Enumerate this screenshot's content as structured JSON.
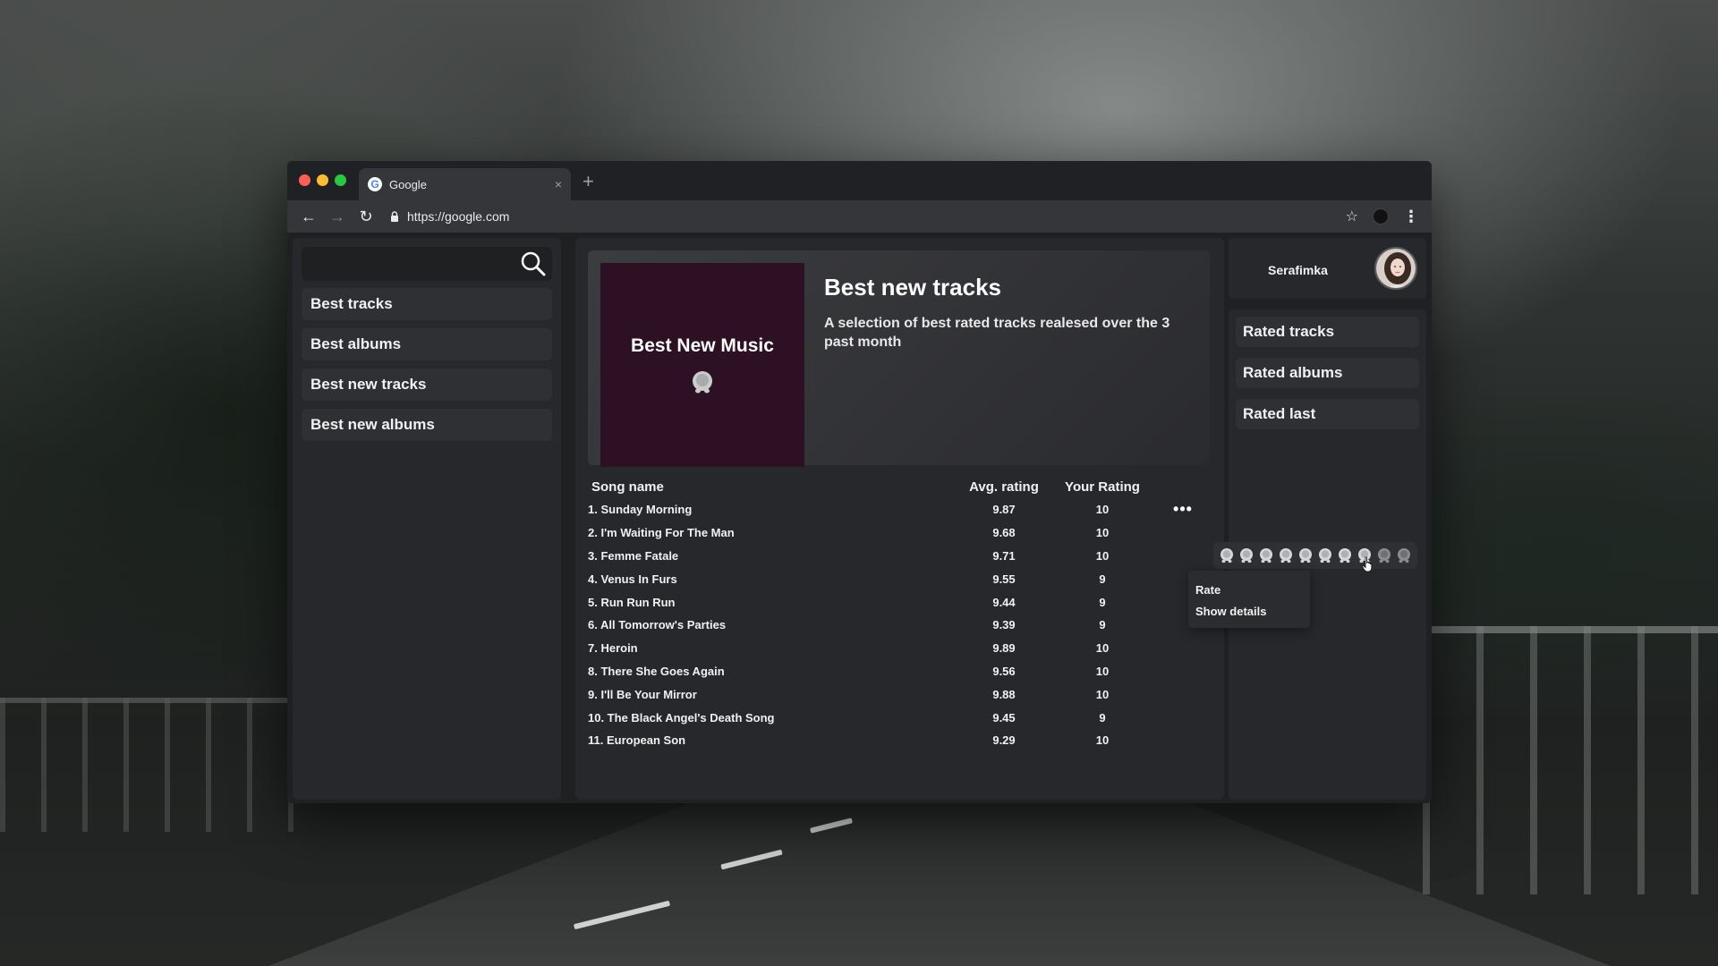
{
  "browser": {
    "tab_title": "Google",
    "tab_favicon": "G",
    "new_tab": "+",
    "close": "×",
    "url": "https://google.com"
  },
  "sidebar": {
    "search_placeholder": "",
    "items": [
      {
        "label": "Best tracks"
      },
      {
        "label": "Best albums"
      },
      {
        "label": "Best new tracks"
      },
      {
        "label": "Best new albums"
      }
    ]
  },
  "main": {
    "cover_title": "Best New Music",
    "title": "Best new tracks",
    "description": "A selection of best rated tracks realesed over the 3 past month",
    "table": {
      "headers": {
        "name": "Song name",
        "avg": "Avg. rating",
        "your": "Your Rating"
      },
      "rows": [
        {
          "name": "1. Sunday Morning",
          "avg": "9.87",
          "your": "10"
        },
        {
          "name": "2. I'm Waiting For The Man",
          "avg": "9.68",
          "your": "10"
        },
        {
          "name": "3. Femme Fatale",
          "avg": "9.71",
          "your": "10"
        },
        {
          "name": "4. Venus In Furs",
          "avg": "9.55",
          "your": "9"
        },
        {
          "name": "5. Run Run Run",
          "avg": "9.44",
          "your": "9"
        },
        {
          "name": "6. All Tomorrow's Parties",
          "avg": "9.39",
          "your": "9"
        },
        {
          "name": "7. Heroin",
          "avg": "9.89",
          "your": "10"
        },
        {
          "name": "8. There She Goes Again",
          "avg": "9.56",
          "your": "10"
        },
        {
          "name": "9. I'll Be Your Mirror",
          "avg": "9.88",
          "your": "10"
        },
        {
          "name": "10. The Black Angel's Death Song",
          "avg": "9.45",
          "your": "9"
        },
        {
          "name": "11. European Son",
          "avg": "9.29",
          "your": "10"
        }
      ],
      "more": "•••"
    }
  },
  "user": {
    "name": "Serafimka"
  },
  "right": {
    "items": [
      {
        "label": "Rated tracks"
      },
      {
        "label": "Rated albums"
      },
      {
        "label": "Rated last"
      }
    ]
  },
  "rating_picker": {
    "max": 10,
    "hovered": 8
  },
  "context_menu": {
    "items": [
      {
        "label": "Rate"
      },
      {
        "label": "Show details"
      }
    ]
  },
  "colors": {
    "cover_bg": "#2e1024",
    "panel_bg": "#27282b",
    "item_bg": "#2f3034"
  }
}
